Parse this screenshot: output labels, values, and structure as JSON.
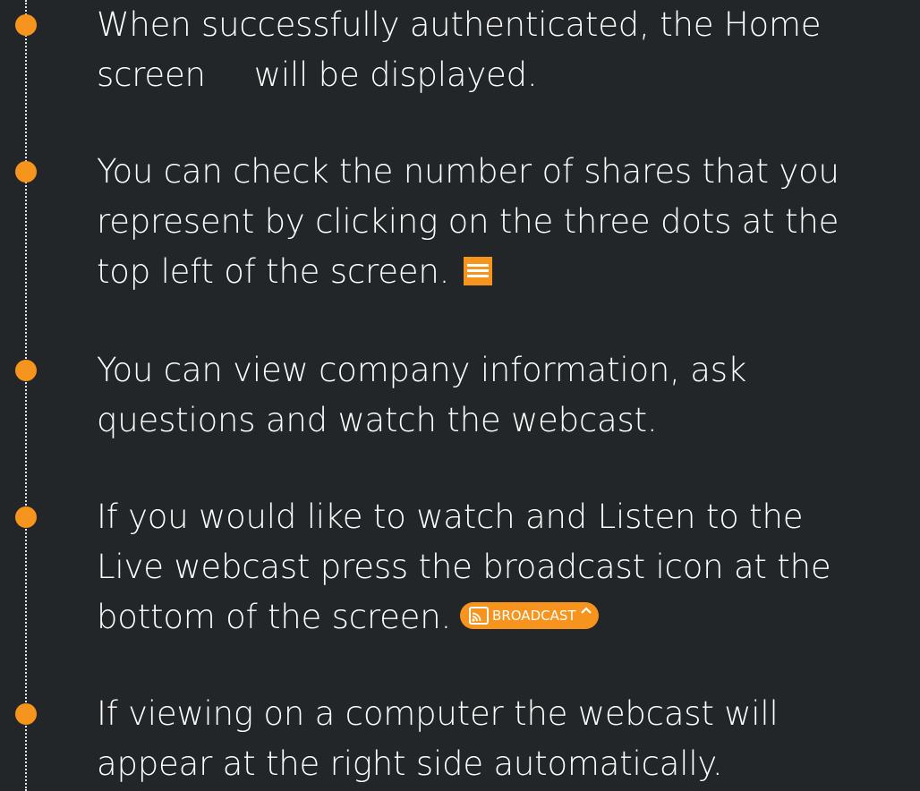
{
  "steps": [
    {
      "line1": "When successfully authenticated, the Home",
      "line2a": "screen",
      "line2b": "will be displayed."
    },
    {
      "line1": "You can check the number of shares that you",
      "line2": "represent by clicking on the three dots at the",
      "line3": "top left of the screen.",
      "icon": "menu-icon"
    },
    {
      "line1": "You can view company information, ask",
      "line2": "questions and watch the webcast."
    },
    {
      "line1": "If you would like to watch and Listen to the",
      "line2": "Live webcast press the broadcast icon at the",
      "line3": "bottom of the screen.",
      "button": {
        "label": "BROADCAST",
        "icon": "cast-icon",
        "chevron": "chevron-up-icon"
      }
    },
    {
      "line1": "If viewing on a computer the webcast will",
      "line2": "appear at the right side automatically."
    }
  ],
  "colors": {
    "background": "#222628",
    "accent": "#f7941d",
    "text": "#ffffff",
    "timeline": "#e6e6e6"
  }
}
